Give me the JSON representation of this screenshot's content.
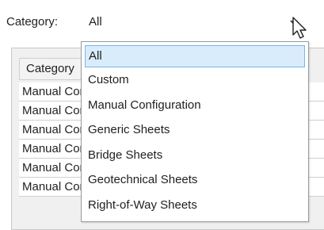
{
  "filter": {
    "label": "Category:",
    "selected": "All"
  },
  "grid": {
    "header": "Category",
    "rows": [
      "Manual Configuration",
      "Manual Configuration",
      "Manual Configuration",
      "Manual Configuration",
      "Manual Configuration",
      "Manual Configuration"
    ]
  },
  "dropdown": {
    "options": [
      "All",
      "Custom",
      "Manual Configuration",
      "Generic Sheets",
      "Bridge Sheets",
      "Geotechnical Sheets",
      "Right-of-Way Sheets"
    ],
    "highlighted": "All"
  },
  "colors": {
    "highlight_bg": "#d9ecfb",
    "highlight_border": "#79b6e8"
  }
}
